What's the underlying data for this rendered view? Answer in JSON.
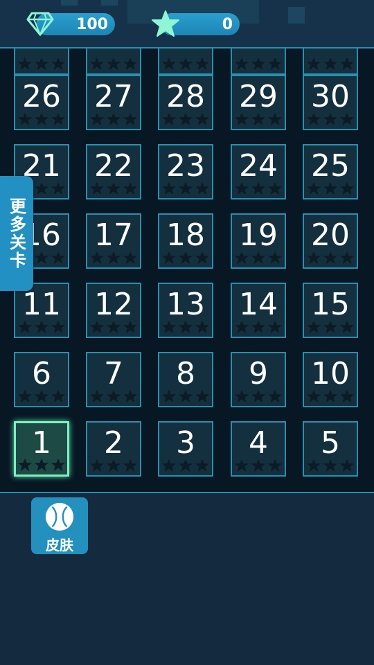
{
  "header": {
    "gems_count": "100",
    "stars_count": "0"
  },
  "levels": [
    {
      "number": "26",
      "stars": 0
    },
    {
      "number": "27",
      "stars": 0
    },
    {
      "number": "28",
      "stars": 0
    },
    {
      "number": "29",
      "stars": 0
    },
    {
      "number": "30",
      "stars": 0
    },
    {
      "number": "21",
      "stars": 0
    },
    {
      "number": "22",
      "stars": 0
    },
    {
      "number": "23",
      "stars": 0
    },
    {
      "number": "24",
      "stars": 0
    },
    {
      "number": "25",
      "stars": 0
    },
    {
      "number": "16",
      "stars": 0
    },
    {
      "number": "17",
      "stars": 0
    },
    {
      "number": "18",
      "stars": 0
    },
    {
      "number": "19",
      "stars": 0
    },
    {
      "number": "20",
      "stars": 0
    },
    {
      "number": "11",
      "stars": 0
    },
    {
      "number": "12",
      "stars": 0
    },
    {
      "number": "13",
      "stars": 0
    },
    {
      "number": "14",
      "stars": 0
    },
    {
      "number": "15",
      "stars": 0
    },
    {
      "number": "6",
      "stars": 0
    },
    {
      "number": "7",
      "stars": 0
    },
    {
      "number": "8",
      "stars": 0
    },
    {
      "number": "9",
      "stars": 0
    },
    {
      "number": "10",
      "stars": 0
    },
    {
      "number": "1",
      "stars": 0,
      "selected": true
    },
    {
      "number": "2",
      "stars": 0
    },
    {
      "number": "3",
      "stars": 0
    },
    {
      "number": "4",
      "stars": 0
    },
    {
      "number": "5",
      "stars": 0
    }
  ],
  "side_tab_label": "更多关卡",
  "skin_button_label": "皮肤",
  "colors": {
    "accent": "#2a8fb0",
    "button_blue": "#2490bd",
    "selected_border": "#7ff0c2",
    "star_empty": "#0b1c26"
  }
}
